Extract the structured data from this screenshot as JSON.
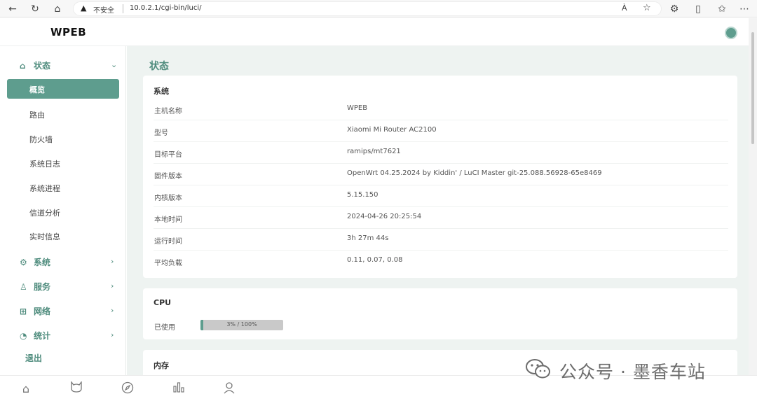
{
  "browser": {
    "insecure_label": "不安全",
    "url": "10.0.2.1/cgi-bin/luci/",
    "read_aloud": "À"
  },
  "header": {
    "brand": "WPEB"
  },
  "sidebar": {
    "status": {
      "label": "状态"
    },
    "status_items": [
      "概览",
      "路由",
      "防火墙",
      "系统日志",
      "系统进程",
      "信道分析",
      "实时信息"
    ],
    "active_index": 0,
    "groups": [
      {
        "label": "系统",
        "icon": "gear-icon"
      },
      {
        "label": "服务",
        "icon": "user-service-icon"
      },
      {
        "label": "网络",
        "icon": "network-icon"
      },
      {
        "label": "统计",
        "icon": "pie-chart-icon"
      }
    ],
    "logout": "退出"
  },
  "main": {
    "title": "状态",
    "system": {
      "title": "系统",
      "rows": [
        {
          "key": "主机名称",
          "value": "WPEB"
        },
        {
          "key": "型号",
          "value": "Xiaomi Mi Router AC2100"
        },
        {
          "key": "目标平台",
          "value": "ramips/mt7621"
        },
        {
          "key": "固件版本",
          "value": "OpenWrt 04.25.2024 by Kiddin' / LuCI Master git-25.088.56928-65e8469"
        },
        {
          "key": "内核版本",
          "value": "5.15.150"
        },
        {
          "key": "本地时间",
          "value": "2024-04-26 20:25:54"
        },
        {
          "key": "运行时间",
          "value": "3h 27m 44s"
        },
        {
          "key": "平均负载",
          "value": "0.11, 0.07, 0.08"
        }
      ]
    },
    "cpu": {
      "title": "CPU",
      "used_label": "已使用",
      "usage_text": "3% / 100%",
      "usage_percent": 3
    },
    "memory": {
      "title": "内存"
    }
  },
  "watermark": {
    "text": "公众号 · 墨香车站"
  },
  "colors": {
    "accent": "#5e9d8e",
    "accent_text": "#4d8b7c",
    "main_bg": "#eef3f1"
  }
}
